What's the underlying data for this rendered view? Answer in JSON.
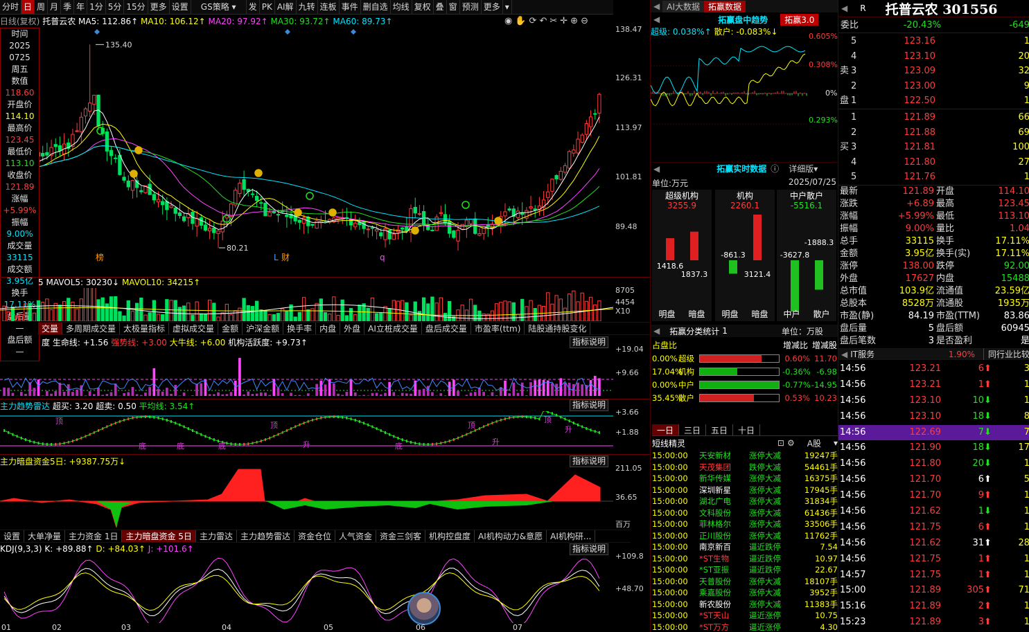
{
  "toolbar": {
    "items": [
      "分时",
      "日",
      "周",
      "月",
      "季",
      "年",
      "1分",
      "5分",
      "15分",
      "更多",
      "设置"
    ],
    "active": "日",
    "strategy": "GS策略",
    "items2": [
      "发",
      "PK",
      "AI解",
      "九转",
      "连板",
      "事件",
      "删自选",
      "均线",
      "复权",
      "叠",
      "窗",
      "预测",
      "更多"
    ]
  },
  "chart_header": {
    "mode": "日线(复权)",
    "name": "托普云农",
    "ma5": "MA5: 112.86↑",
    "ma10": "MA10: 106.12↑",
    "ma20": "MA20: 97.92↑",
    "ma30": "MA30: 93.72↑",
    "ma60": "MA60: 89.73↑"
  },
  "price_axis": [
    "138.47",
    "126.31",
    "113.97",
    "101.81",
    "89.48"
  ],
  "price_annotations": {
    "high": "135.40",
    "low": "80.21",
    "tag1": "榜",
    "tag2": "L",
    "tag3": "财",
    "tag4": "q"
  },
  "info_box": {
    "rows": [
      {
        "label": "时间",
        "value": "2025"
      },
      {
        "label": "",
        "value": "0725"
      },
      {
        "label": "周五",
        "value": ""
      },
      {
        "label": "数值",
        "value": "118.60"
      },
      {
        "label": "开盘价",
        "value": "114.10"
      },
      {
        "label": "最高价",
        "value": "123.45"
      },
      {
        "label": "最低价",
        "value": "113.10"
      },
      {
        "label": "收盘价",
        "value": "121.89"
      },
      {
        "label": "涨幅",
        "value": "+5.99%"
      },
      {
        "label": "振幅",
        "value": "9.00%"
      },
      {
        "label": "成交量",
        "value": "33115"
      },
      {
        "label": "成交额",
        "value": "3.95亿"
      },
      {
        "label": "换手",
        "value": "17.11%"
      },
      {
        "label": "盘后量",
        "value": "—"
      },
      {
        "label": "盘后额",
        "value": "—"
      }
    ]
  },
  "volume_header": {
    "mavol5": "MAVOL5: 30230↓",
    "mavol10": "MAVOL10: 34215↑",
    "prefix": "5"
  },
  "volume_axis": [
    "8705",
    "4454",
    "X10"
  ],
  "indicator_tabs1": [
    "交量",
    "多周期成交量",
    "太极量指标",
    "虚拟成交量",
    "金额",
    "沪深金额",
    "换手率",
    "内盘",
    "外盘",
    "AI立桩成交量",
    "盘后成交量",
    "市盈率(ttm)",
    "陆股通持股变化"
  ],
  "ind1": {
    "title": "度 生命线: +1.56",
    "l2": "强势线: +3.00",
    "l3": "大牛线: +6.00",
    "l4": "机构活跃度: +9.73↑",
    "axis": [
      "+19.04",
      "+9.66"
    ],
    "note": "指标说明"
  },
  "ind2": {
    "title": "主力趋势雷达",
    "l1": "超买: 3.20",
    "l2": "超卖: 0.50",
    "l3": "平均线: 3.54↑",
    "axis": [
      "+3.66",
      "+1.88"
    ],
    "note": "指标说明",
    "marks": [
      "顶",
      "底",
      "底",
      "底",
      "顶",
      "升",
      "底",
      "顶",
      "升",
      "顶",
      "升"
    ]
  },
  "ind3": {
    "title": "主力暗盘资金5日: +9387.75万↓",
    "axis": [
      "211.05",
      "36.65",
      "百万"
    ],
    "note": "指标说明"
  },
  "indicator_tabs2": [
    "设置",
    "大单净量",
    "主力资金 1日",
    "主力暗盘资金 5日",
    "主力雷达",
    "主力趋势雷达",
    "资金仓位",
    "人气资金",
    "资金三剑客",
    "机构控盘度",
    "AI机构动力&意愿",
    "AI机构研..."
  ],
  "ind4": {
    "title": "KDJ(9,3,3)",
    "k": "K: +89.88↑",
    "d": "D: +84.03↑",
    "j": "J: +101.6↑",
    "axis": [
      "+109.8",
      "+48.70"
    ],
    "note": "指标说明"
  },
  "x_axis": [
    "01",
    "02",
    "03",
    "04",
    "05",
    "06",
    "07"
  ],
  "mid": {
    "tabs": [
      "AI大数据",
      "拓赢数据"
    ],
    "trend_title": "拓赢盘中趋势",
    "trend_badge": "拓赢3.0",
    "super": "超级: 0.038%↑",
    "retail": "散户: -0.083%↓",
    "trend_axis": [
      "0.605%",
      "0.308%",
      "0%",
      "0.293%"
    ],
    "realtime_title": "拓赢实时数据",
    "detail": "详细版",
    "unit": "单位:万元",
    "date": "2025/07/25",
    "groups": [
      {
        "name": "超级机构",
        "total": "3255.9",
        "v1": "1418.6",
        "v2": "1837.3",
        "l1": "明盘",
        "l2": "暗盘"
      },
      {
        "name": "机构",
        "total": "2260.1",
        "v1": "-861.3",
        "v2": "3121.4",
        "l1": "明盘",
        "l2": "暗盘"
      },
      {
        "name": "中户散户",
        "total": "-5516.1",
        "v1": "-3627.8",
        "v2": "-1888.3",
        "l1": "中户",
        "l2": "散户"
      }
    ],
    "class_title": "拓赢分类统计",
    "class_page": "1",
    "class_unit": "单位：万股",
    "pct_header": [
      "占盘比",
      "增减比",
      "增减股"
    ],
    "pct_rows": [
      {
        "pct": "0.00%",
        "name": "超级",
        "fill": 0.78,
        "color": "#d02020",
        "chg": "0.60%",
        "shares": "11.70"
      },
      {
        "pct": "17.04%",
        "name": "机构",
        "fill": 0.47,
        "color": "#10b010",
        "chg": "-0.36%",
        "shares": "-6.98"
      },
      {
        "pct": "0.00%",
        "name": "中户",
        "fill": 1.0,
        "color": "#10b010",
        "chg": "-0.77%",
        "shares": "-14.95"
      },
      {
        "pct": "35.45%",
        "name": "散户",
        "fill": 0.68,
        "color": "#d02020",
        "chg": "0.53%",
        "shares": "10.23"
      }
    ],
    "period_tabs": [
      "一日",
      "三日",
      "五日",
      "十日"
    ],
    "list_title": "短线精灵",
    "list_market": "A股",
    "list": [
      {
        "t": "15:00:00",
        "n": "天安新材",
        "e": "涨停大减",
        "v": "19247手",
        "nc": "g",
        "ec": "g"
      },
      {
        "t": "15:00:00",
        "n": "天茂集团",
        "e": "跌停大减",
        "v": "54461手",
        "nc": "r",
        "ec": "g"
      },
      {
        "t": "15:00:00",
        "n": "新华传媒",
        "e": "涨停大减",
        "v": "16375手",
        "nc": "g",
        "ec": "g"
      },
      {
        "t": "15:00:00",
        "n": "深圳新星",
        "e": "涨停大减",
        "v": "17945手",
        "nc": "w",
        "ec": "g"
      },
      {
        "t": "15:00:00",
        "n": "湖北广电",
        "e": "涨停大减",
        "v": "31834手",
        "nc": "g",
        "ec": "g"
      },
      {
        "t": "15:00:00",
        "n": "文科股份",
        "e": "涨停大减",
        "v": "61436手",
        "nc": "g",
        "ec": "g"
      },
      {
        "t": "15:00:00",
        "n": "菲林格尔",
        "e": "涨停大减",
        "v": "33506手",
        "nc": "g",
        "ec": "g"
      },
      {
        "t": "15:00:00",
        "n": "正川股份",
        "e": "涨停大减",
        "v": "11762手",
        "nc": "g",
        "ec": "g"
      },
      {
        "t": "15:00:00",
        "n": "南京新百",
        "e": "逼近跌停",
        "v": "7.54",
        "nc": "w",
        "ec": "g"
      },
      {
        "t": "15:00:00",
        "n": "*ST生物",
        "e": "逼近跌停",
        "v": "10.97",
        "nc": "r",
        "ec": "g"
      },
      {
        "t": "15:00:00",
        "n": "*ST亚振",
        "e": "逼近跌停",
        "v": "22.67",
        "nc": "g",
        "ec": "g"
      },
      {
        "t": "15:00:00",
        "n": "天普股份",
        "e": "涨停大减",
        "v": "18107手",
        "nc": "g",
        "ec": "g"
      },
      {
        "t": "15:00:00",
        "n": "乘嘉股份",
        "e": "涨停大减",
        "v": "3952手",
        "nc": "g",
        "ec": "g"
      },
      {
        "t": "15:00:00",
        "n": "新农股份",
        "e": "涨停大减",
        "v": "11383手",
        "nc": "w",
        "ec": "g"
      },
      {
        "t": "15:00:00",
        "n": "*ST天山",
        "e": "逼近涨停",
        "v": "10.75",
        "nc": "r",
        "ec": "g"
      },
      {
        "t": "15:00:00",
        "n": "*ST万方",
        "e": "逼近涨停",
        "v": "4.30",
        "nc": "r",
        "ec": "g"
      }
    ]
  },
  "right": {
    "r_tag": "R",
    "title": "托普云农 301556",
    "weibi_label": "委比",
    "weibi": "-20.43%",
    "weibi2": "-649",
    "sell_label": "卖盘",
    "buy_label": "买盘",
    "sells": [
      {
        "lv": "5",
        "p": "123.16",
        "v": "1"
      },
      {
        "lv": "4",
        "p": "123.10",
        "v": "20"
      },
      {
        "lv": "3",
        "p": "123.09",
        "v": "32"
      },
      {
        "lv": "2",
        "p": "123.00",
        "v": "9"
      },
      {
        "lv": "1",
        "p": "122.50",
        "v": "1"
      }
    ],
    "buys": [
      {
        "lv": "1",
        "p": "121.89",
        "v": "66"
      },
      {
        "lv": "2",
        "p": "121.88",
        "v": "69"
      },
      {
        "lv": "3",
        "p": "121.81",
        "v": "100"
      },
      {
        "lv": "4",
        "p": "121.80",
        "v": "27"
      },
      {
        "lv": "5",
        "p": "121.76",
        "v": "1"
      }
    ],
    "stats": [
      {
        "l1": "最新",
        "v1": "121.89",
        "c1": "r",
        "l2": "开盘",
        "v2": "114.10",
        "c2": "r"
      },
      {
        "l1": "涨跌",
        "v1": "+6.89",
        "c1": "r",
        "l2": "最高",
        "v2": "123.45",
        "c2": "r"
      },
      {
        "l1": "涨幅",
        "v1": "+5.99%",
        "c1": "r",
        "l2": "最低",
        "v2": "113.10",
        "c2": "r"
      },
      {
        "l1": "振幅",
        "v1": "9.00%",
        "c1": "r",
        "l2": "量比",
        "v2": "1.04",
        "c2": "r"
      },
      {
        "l1": "总手",
        "v1": "33115",
        "c1": "y",
        "l2": "换手",
        "v2": "17.11%",
        "c2": "y"
      },
      {
        "l1": "金额",
        "v1": "3.95亿",
        "c1": "y",
        "l2": "换手(实)",
        "v2": "17.11%",
        "c2": "y"
      },
      {
        "l1": "涨停",
        "v1": "138.00",
        "c1": "r",
        "l2": "跌停",
        "v2": "92.00",
        "c2": "g"
      },
      {
        "l1": "外盘",
        "v1": "17627",
        "c1": "r",
        "l2": "内盘",
        "v2": "15488",
        "c2": "g"
      },
      {
        "l1": "总市值",
        "v1": "103.9亿",
        "c1": "y",
        "l2": "流通值",
        "v2": "23.59亿",
        "c2": "y"
      },
      {
        "l1": "总股本",
        "v1": "8528万",
        "c1": "y",
        "l2": "流通股",
        "v2": "1935万",
        "c2": "y"
      },
      {
        "l1": "市盈(静)",
        "v1": "84.19",
        "c1": "w",
        "l2": "市盈(TTM)",
        "v2": "83.86",
        "c2": "w"
      },
      {
        "l1": "盘后量",
        "v1": "5",
        "c1": "w",
        "l2": "盘后额",
        "v2": "60945",
        "c2": "w"
      },
      {
        "l1": "盘后笔数",
        "v1": "3",
        "c1": "w",
        "l2": "是否盈利",
        "v2": "是",
        "c2": "w"
      }
    ],
    "sector": "IT服务",
    "sector_pct": "1.90%",
    "sector_btn": "同行业比较",
    "ticks": [
      {
        "t": "14:56",
        "p": "123.21",
        "v": "6",
        "d": "up",
        "x": "3"
      },
      {
        "t": "14:56",
        "p": "123.21",
        "v": "1",
        "d": "up",
        "x": "1"
      },
      {
        "t": "14:56",
        "p": "123.10",
        "v": "10",
        "d": "down",
        "x": "1"
      },
      {
        "t": "14:56",
        "p": "123.10",
        "v": "18",
        "d": "down",
        "x": "8"
      },
      {
        "t": "14:56",
        "p": "122.69",
        "v": "7",
        "d": "down",
        "x": "7",
        "hl": true
      },
      {
        "t": "14:56",
        "p": "121.90",
        "v": "18",
        "d": "down",
        "x": "17"
      },
      {
        "t": "14:56",
        "p": "121.80",
        "v": "20",
        "d": "down",
        "x": "1"
      },
      {
        "t": "14:56",
        "p": "121.70",
        "v": "6",
        "d": "upw",
        "x": "5"
      },
      {
        "t": "14:56",
        "p": "121.70",
        "v": "9",
        "d": "up",
        "x": "1"
      },
      {
        "t": "14:56",
        "p": "121.62",
        "v": "1",
        "d": "down",
        "x": "1"
      },
      {
        "t": "14:56",
        "p": "121.75",
        "v": "6",
        "d": "up",
        "x": "1"
      },
      {
        "t": "14:56",
        "p": "121.62",
        "v": "31",
        "d": "upw",
        "x": "28"
      },
      {
        "t": "14:56",
        "p": "121.75",
        "v": "1",
        "d": "up",
        "x": "1"
      },
      {
        "t": "14:57",
        "p": "121.75",
        "v": "1",
        "d": "up",
        "x": "1"
      },
      {
        "t": "15:00",
        "p": "121.89",
        "v": "305",
        "d": "up",
        "x": "71"
      },
      {
        "t": "15:16",
        "p": "121.89",
        "v": "2",
        "d": "up",
        "x": "1"
      },
      {
        "t": "15:23",
        "p": "121.89",
        "v": "3",
        "d": "up",
        "x": "1"
      }
    ]
  }
}
